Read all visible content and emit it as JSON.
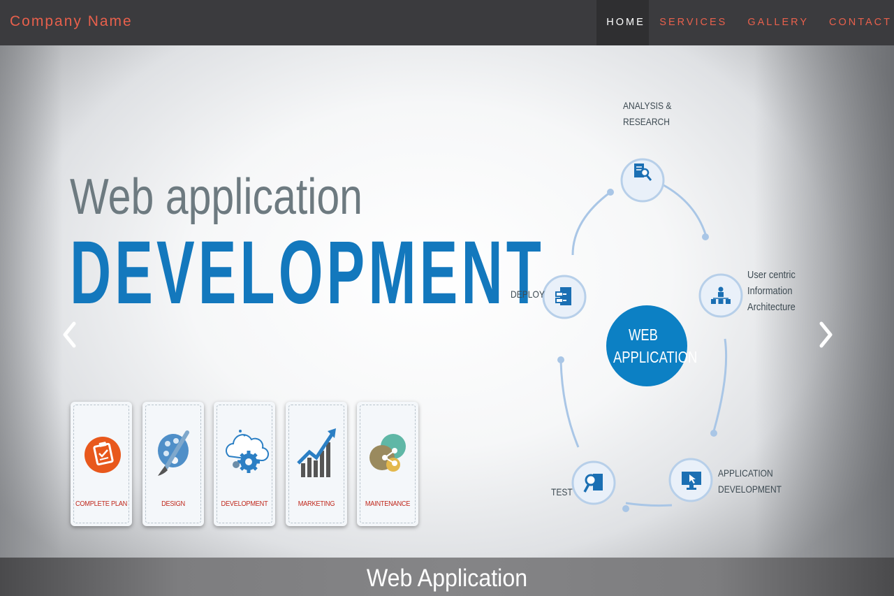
{
  "navbar": {
    "brand": "Company Name",
    "items": [
      {
        "label": "HOME",
        "active": true
      },
      {
        "label": "SERVICES",
        "active": false
      },
      {
        "label": "GALLERY",
        "active": false
      },
      {
        "label": "CONTACT",
        "active": false
      }
    ]
  },
  "hero": {
    "title_line1": "Web application",
    "title_line2": "DEVELOPMENT",
    "cards": [
      {
        "label": "COMPLETE PLAN",
        "icon": "clipboard-icon"
      },
      {
        "label": "DESIGN",
        "icon": "palette-brush-icon"
      },
      {
        "label": "DEVELOPMENT",
        "icon": "cloud-gear-icon"
      },
      {
        "label": "MARKETING",
        "icon": "bar-chart-arrow-icon"
      },
      {
        "label": "MAINTENANCE",
        "icon": "share-icon"
      }
    ],
    "diagram": {
      "center_line1": "WEB",
      "center_line2": "APPLICATION",
      "nodes": {
        "analysis": "ANALYSIS &\nRESEARCH",
        "architecture": "User centric\nInformation\nArchitecture",
        "development": "APPLICATION\nDEVELOPMENT",
        "test": "TEST",
        "deploy": "DEPLOY"
      }
    },
    "prev_icon": "chevron-left-icon",
    "next_icon": "chevron-right-icon"
  },
  "caption": "Web Application",
  "colors": {
    "brand": "#e8604c",
    "navbar_bg": "#3b3b3e",
    "accent_blue": "#1378bd",
    "card_label": "#c0281c"
  }
}
